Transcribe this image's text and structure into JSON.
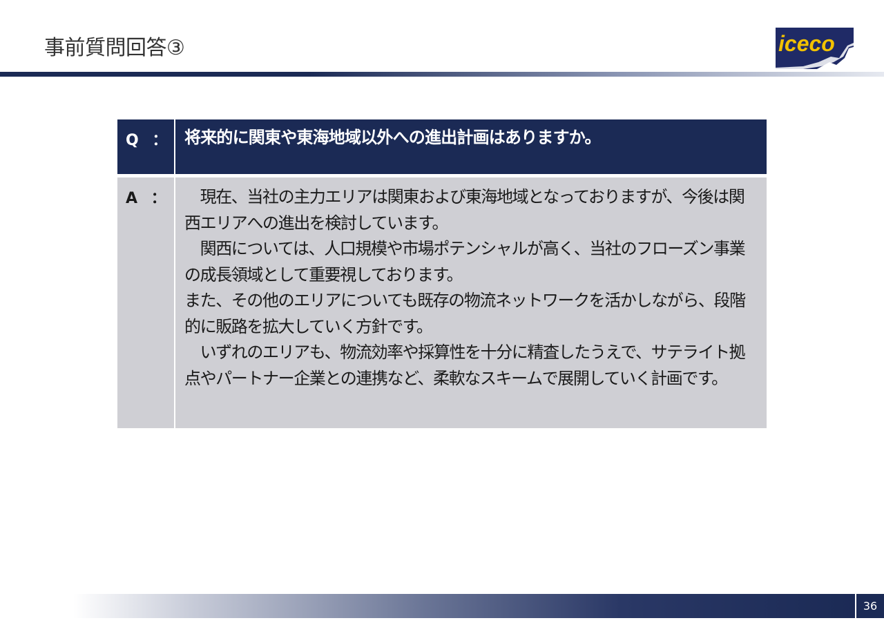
{
  "header": {
    "title": "事前質問回答③",
    "logo_text": "iceco"
  },
  "qa": {
    "question_label": "Q ：",
    "question_text": "将来的に関東や東海地域以外への進出計画はありますか。",
    "answer_label": "A ：",
    "answer_paragraphs": [
      "　現在、当社の主力エリアは関東および東海地域となっておりますが、今後は関西エリアへの進出を検討しています。",
      "　関西については、人口規模や市場ポテンシャルが高く、当社のフローズン事業の成長領域として重要視しております。",
      "また、その他のエリアについても既存の物流ネットワークを活かしながら、段階的に販路を拡大していく方針です。",
      "　いずれのエリアも、物流効率や採算性を十分に精査したうえで、サテライト拠点やパートナー企業との連携など、柔軟なスキームで展開していく計画です。"
    ]
  },
  "footer": {
    "page_number": "36"
  },
  "colors": {
    "navy": "#1b2a55",
    "answer_bg": "#cfcfd4",
    "logo_bg": "#1f2a66",
    "logo_text": "#f2c200"
  }
}
